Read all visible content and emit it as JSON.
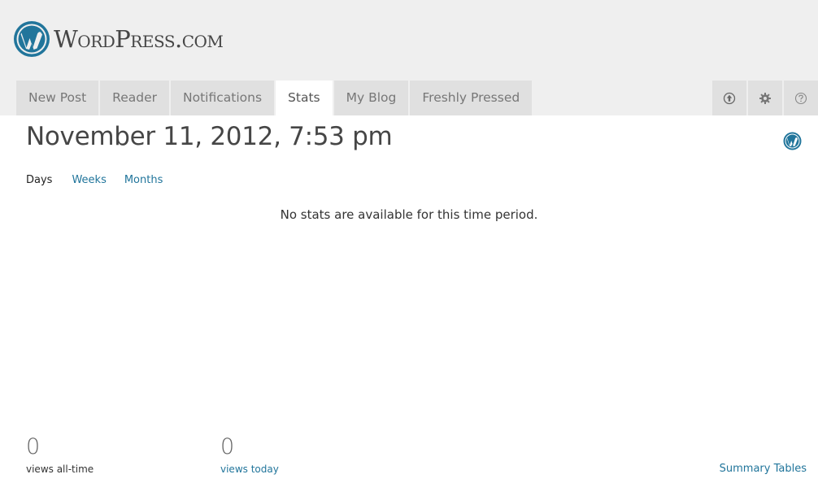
{
  "brand": {
    "text": "WordPress.com"
  },
  "nav": {
    "tabs": [
      {
        "label": "New Post"
      },
      {
        "label": "Reader"
      },
      {
        "label": "Notifications"
      },
      {
        "label": "Stats"
      },
      {
        "label": "My Blog"
      },
      {
        "label": "Freshly Pressed"
      }
    ],
    "active_tab": "Stats",
    "icons": [
      "upload-icon",
      "gear-icon",
      "help-icon"
    ]
  },
  "page": {
    "title": "November 11, 2012, 7:53 pm"
  },
  "period_nav": {
    "days": "Days",
    "weeks": "Weeks",
    "months": "Months",
    "selected": "Days"
  },
  "empty_message": "No stats are available for this time period.",
  "stats": {
    "all_time": {
      "value": "0",
      "label": "views all-time"
    },
    "today": {
      "value": "0",
      "label": "views today"
    }
  },
  "summary_link": "Summary Tables",
  "colors": {
    "link": "#21759b",
    "header_bg": "#efefef",
    "tab_bg": "#e0e0e0",
    "logo_blue": "#21759b"
  }
}
